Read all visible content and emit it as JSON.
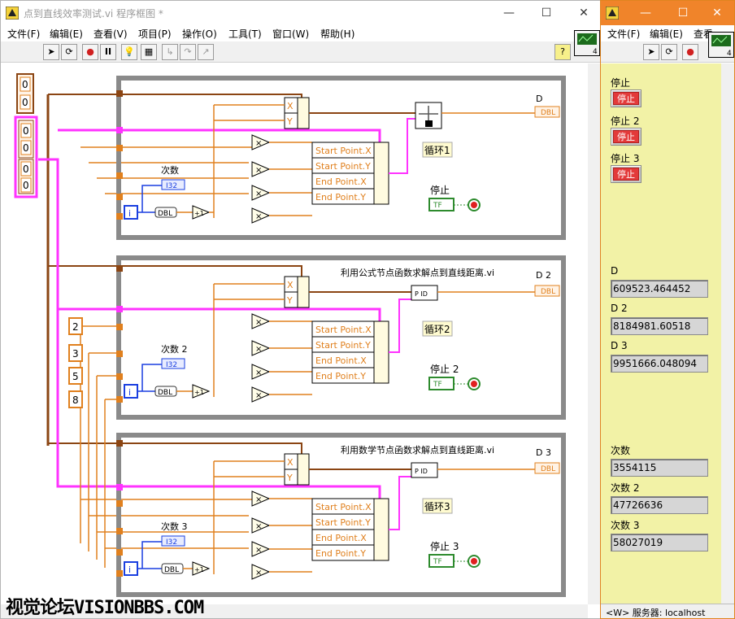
{
  "diagram": {
    "title": "点到直线效率测试.vi 程序框图 *",
    "menu": [
      "文件(F)",
      "编辑(E)",
      "查看(V)",
      "项目(P)",
      "操作(O)",
      "工具(T)",
      "窗口(W)",
      "帮助(H)"
    ],
    "help_button": "?",
    "vi_icon_number": "4",
    "constants": {
      "c1": "0",
      "c2": "0",
      "array_a1": "0",
      "array_a2": "0",
      "array_b1": "0",
      "array_b2": "0",
      "n1": "2",
      "n2": "3",
      "n3": "5",
      "n4": "8"
    },
    "loops": [
      {
        "count_label": "次数",
        "indicator_label": "D",
        "indicator_type": "DBL",
        "iter_type": "I32",
        "loop_label": "循环1",
        "stop_label": "停止",
        "iter_terminal": "i",
        "conv": "DBL",
        "inc": "+1",
        "xy": [
          "X",
          "Y"
        ],
        "cluster": [
          "Start Point.X",
          "Start Point.Y",
          "End Point.X",
          "End Point.Y"
        ],
        "subvi": ""
      },
      {
        "count_label": "次数 2",
        "indicator_label": "D 2",
        "indicator_type": "DBL",
        "iter_type": "I32",
        "loop_label": "循环2",
        "stop_label": "停止 2",
        "iter_terminal": "i",
        "conv": "DBL",
        "inc": "+1",
        "xy": [
          "X",
          "Y"
        ],
        "cluster": [
          "Start Point.X",
          "Start Point.Y",
          "End Point.X",
          "End Point.Y"
        ],
        "subvi": "利用公式节点函数求解点到直线距离.vi"
      },
      {
        "count_label": "次数 3",
        "indicator_label": "D 3",
        "indicator_type": "DBL",
        "iter_type": "I32",
        "loop_label": "循环3",
        "stop_label": "停止 3",
        "iter_terminal": "i",
        "conv": "DBL",
        "inc": "+1",
        "xy": [
          "X",
          "Y"
        ],
        "cluster": [
          "Start Point.X",
          "Start Point.Y",
          "End Point.X",
          "End Point.Y"
        ],
        "subvi": "利用数学节点函数求解点到直线距离.vi"
      }
    ],
    "stop_terminal": "TF",
    "multiply": "×",
    "watermark": "视觉论坛VISIONBBS.COM"
  },
  "panel": {
    "menu": [
      "文件(F)",
      "编辑(E)",
      "查看"
    ],
    "vi_icon_number": "4",
    "stops": [
      {
        "label": "停止",
        "button": "停止"
      },
      {
        "label": "停止 2",
        "button": "停止"
      },
      {
        "label": "停止 3",
        "button": "停止"
      }
    ],
    "distances": [
      {
        "label": "D",
        "value": "609523.464452"
      },
      {
        "label": "D 2",
        "value": "8184981.60518"
      },
      {
        "label": "D 3",
        "value": "9951666.048094"
      }
    ],
    "counts": [
      {
        "label": "次数",
        "value": "3554115"
      },
      {
        "label": "次数 2",
        "value": "47726636"
      },
      {
        "label": "次数 3",
        "value": "58027019"
      }
    ],
    "status": "<W> 服务器: localhost"
  },
  "colors": {
    "orange_wire": "#e0801e",
    "pink_wire": "#ff33ff",
    "blue_wire": "#1a3fe0",
    "brown_wire": "#8b4513",
    "loop_frame": "#8a8a8a",
    "panel_bg": "#f2f2a6",
    "titlebar_active": "#f0842a",
    "green_terminal": "#2e8b2e"
  }
}
